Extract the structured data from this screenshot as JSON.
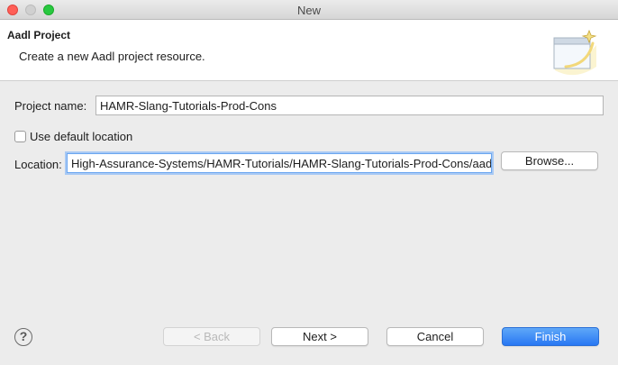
{
  "window": {
    "title": "New"
  },
  "header": {
    "title": "Aadl Project",
    "description": "Create a new Aadl project resource.",
    "icon": "new-project-wizard-icon"
  },
  "form": {
    "project_name_label": "Project name:",
    "project_name_value": "HAMR-Slang-Tutorials-Prod-Cons",
    "use_default_location_label": "Use default location",
    "use_default_location_checked": false,
    "location_label": "Location:",
    "location_value": "High-Assurance-Systems/HAMR-Tutorials/HAMR-Slang-Tutorials-Prod-Cons/aadl",
    "browse_label": "Browse..."
  },
  "footer": {
    "help_icon": "help-icon",
    "help_glyph": "?",
    "back_label": "< Back",
    "next_label": "Next >",
    "cancel_label": "Cancel",
    "finish_label": "Finish"
  },
  "colors": {
    "primary_button": "#2877f3",
    "focus_ring": "#a8c9f4",
    "close_button": "#ff5f57",
    "maximize_button": "#28c840"
  }
}
